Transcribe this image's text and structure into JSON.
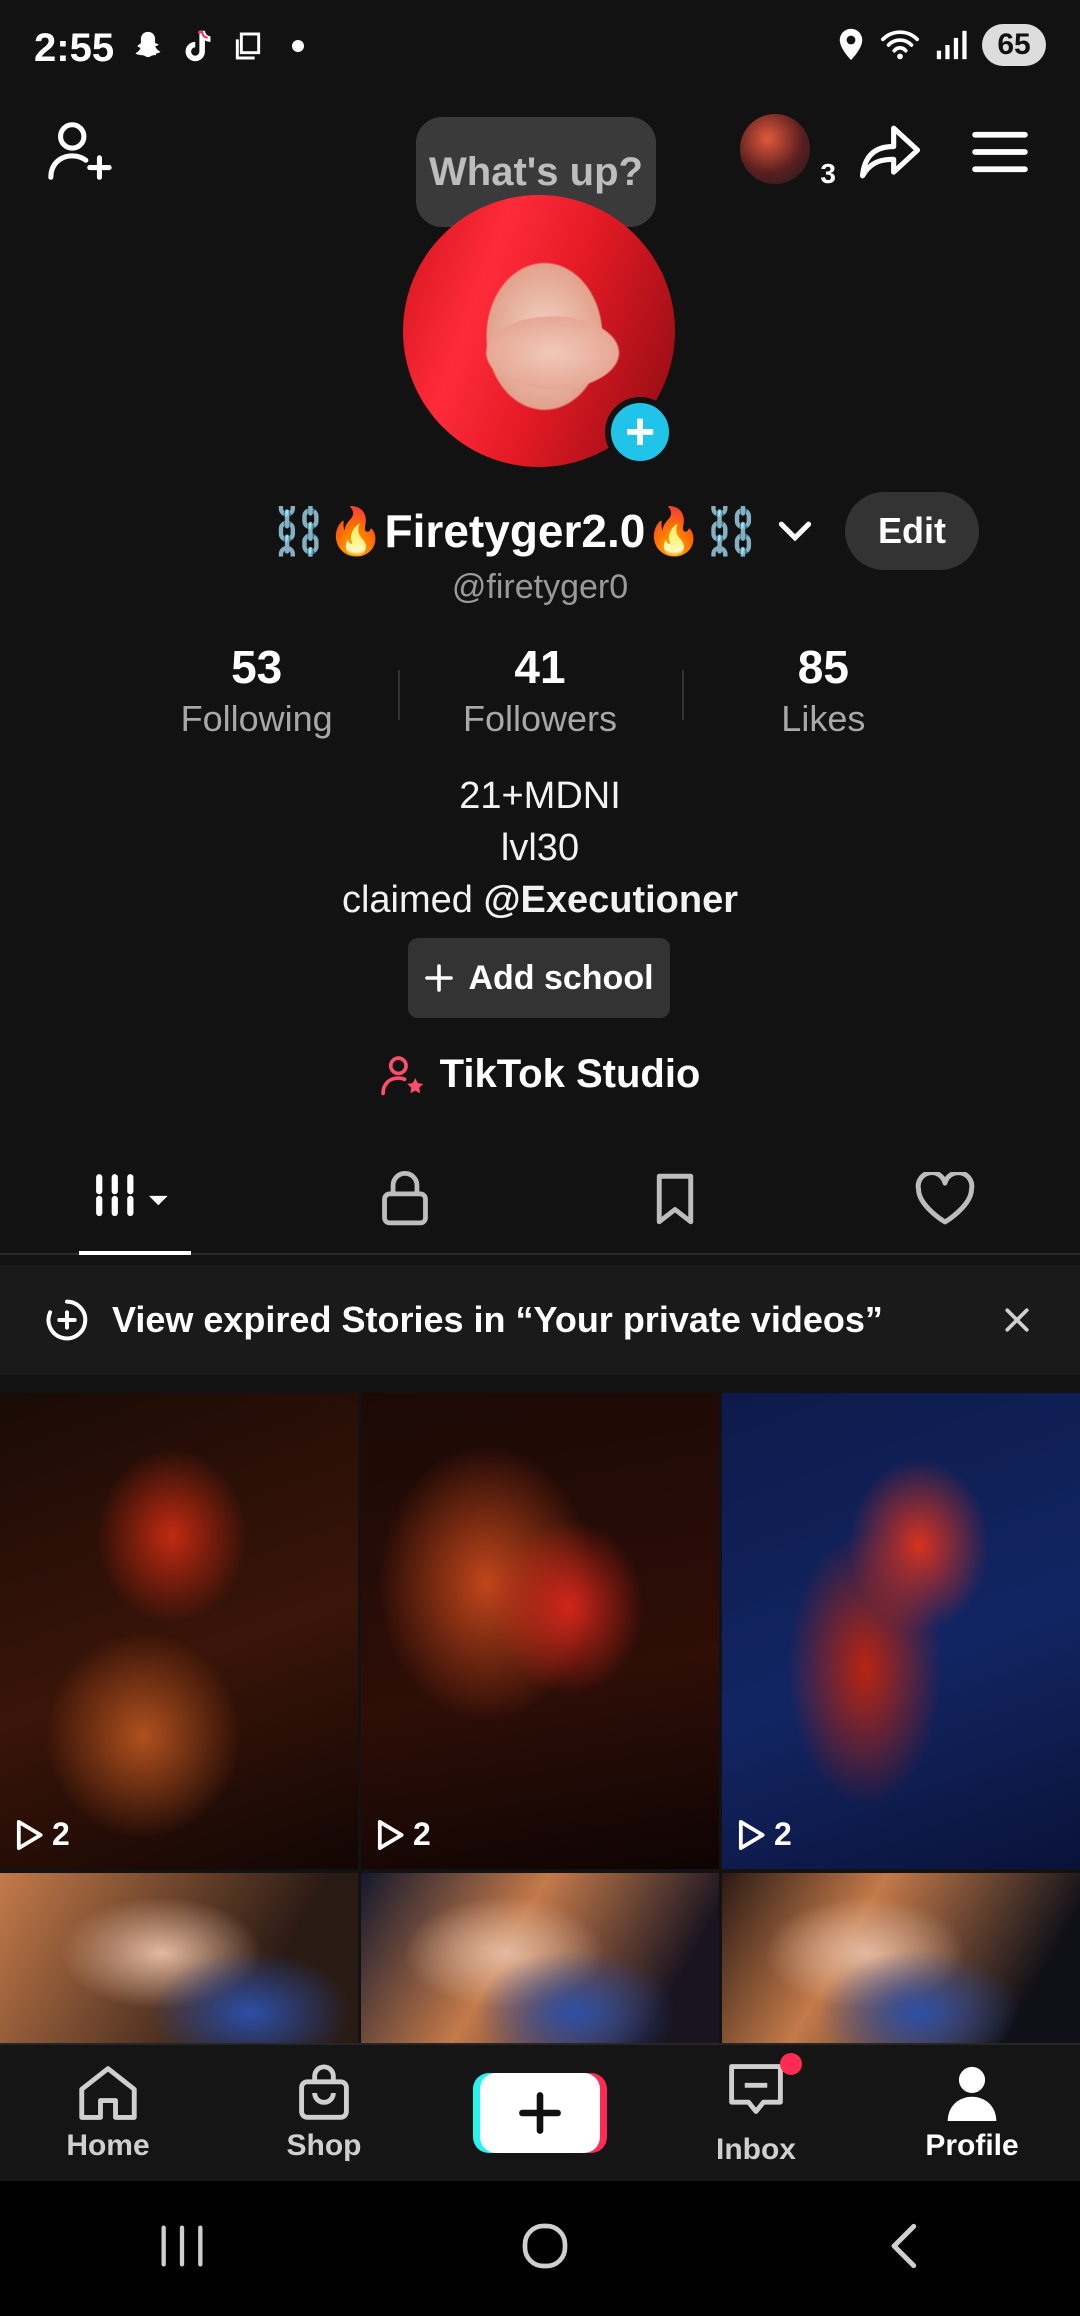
{
  "status_bar": {
    "time": "2:55",
    "battery": "65"
  },
  "header": {
    "bubble_text": "What's up?",
    "avatar_count": "3"
  },
  "profile": {
    "display_name": "⛓️🔥Firetyger2.0🔥⛓️",
    "handle": "@firetyger0",
    "edit_label": "Edit",
    "stats": [
      {
        "value": "53",
        "label": "Following"
      },
      {
        "value": "41",
        "label": "Followers"
      },
      {
        "value": "85",
        "label": "Likes"
      }
    ],
    "bio": {
      "line1": "21+MDNI",
      "line2": "lvl30",
      "line3_prefix": "claimed ",
      "line3_mention": "@Executioner"
    },
    "add_school_label": "Add school",
    "studio_label": "TikTok Studio"
  },
  "banner": {
    "text": "View expired Stories in “Your private videos”"
  },
  "grid": {
    "tiles": [
      {
        "views": "2"
      },
      {
        "views": "2"
      },
      {
        "views": "2"
      },
      {
        "views": ""
      },
      {
        "views": ""
      },
      {
        "views": ""
      }
    ]
  },
  "bottom_nav": {
    "home": "Home",
    "shop": "Shop",
    "inbox": "Inbox",
    "profile": "Profile"
  },
  "colors": {
    "accent_cyan": "#20c4e8",
    "accent_red": "#fe2c55",
    "studio_icon": "#ff4d6d"
  }
}
